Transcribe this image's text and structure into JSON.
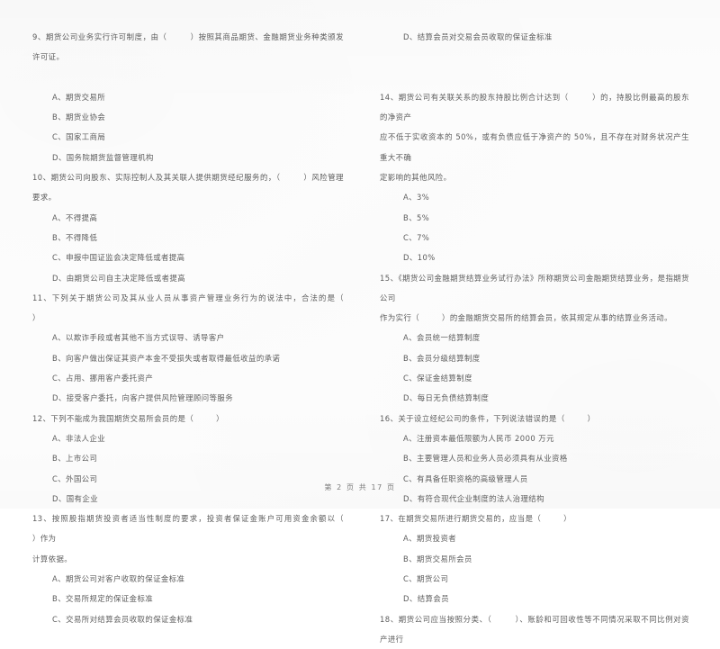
{
  "document": {
    "type": "exam-paper-scan",
    "language": "zh-CN",
    "footer": "第 2 页 共 17 页",
    "page_number": "2",
    "total_pages": "17"
  },
  "left_column": {
    "questions": [
      {
        "number": "9",
        "stem": "9、期货公司业务实行许可制度，由（        ）按照其商品期货、金融期货业务种类颁发许可证。",
        "blank_after_stem": true,
        "options": [
          "A、期货交易所",
          "B、期货业协会",
          "C、国家工商局",
          "D、国务院期货监督管理机构"
        ]
      },
      {
        "number": "10",
        "stem": "10、期货公司向股东、实际控制人及其关联人提供期货经纪服务的，（        ）风险管理要求。",
        "blank_after_stem": false,
        "options": [
          "A、不得提高",
          "B、不得降低",
          "C、申报中国证监会决定降低或者提高",
          "D、由期货公司自主决定降低或者提高"
        ]
      },
      {
        "number": "11",
        "stem": "11、下列关于期货公司及其从业人员从事资产管理业务行为的说法中，合法的是（        ）",
        "blank_after_stem": false,
        "options": [
          "A、以欺诈手段或者其他不当方式误导、诱导客户",
          "B、向客户做出保证其资产本金不受损失或者取得最低收益的承诺",
          "C、占用、挪用客户委托资产",
          "D、接受客户委托，向客户提供风险管理顾问等服务"
        ]
      },
      {
        "number": "12",
        "stem": "12、下列不能成为我国期货交易所会员的是（        ）",
        "blank_after_stem": false,
        "options": [
          "A、非法人企业",
          "B、上市公司",
          "C、外国公司",
          "D、国有企业"
        ]
      },
      {
        "number": "13",
        "stem": "13、按照股指期货投资者适当性制度的要求，投资者保证金账户可用资金余额以（        ）作为\n计算依据。",
        "blank_after_stem": false,
        "options": [
          "A、期货公司对客户收取的保证金标准",
          "B、交易所规定的保证金标准",
          "C、交易所对结算会员收取的保证金标准"
        ]
      }
    ]
  },
  "right_column": {
    "leading_option": "D、结算会员对交易会员收取的保证金标准",
    "questions": [
      {
        "number": "14",
        "stem": "14、期货公司有关联关系的股东持股比例合计达到（        ）的，持股比例最高的股东的净资产\n应不低于实收资本的 50%，或有负债应低于净资产的 50%，且不存在对财务状况产生重大不确\n定影响的其他风险。",
        "options": [
          "A、3%",
          "B、5%",
          "C、7%",
          "D、10%"
        ]
      },
      {
        "number": "15",
        "stem": "15、《期货公司金融期货结算业务试行办法》所称期货公司金融期货结算业务，是指期货公司\n作为实行（        ）的金融期货交易所的结算会员，依其规定从事的结算业务活动。",
        "options": [
          "A、会员统一结算制度",
          "B、会员分级结算制度",
          "C、保证金结算制度",
          "D、每日无负债结算制度"
        ]
      },
      {
        "number": "16",
        "stem": "16、关于设立经纪公司的条件，下列说法错误的是（        ）",
        "options": [
          "A、注册资本最低限额为人民币 2000 万元",
          "B、主要管理人员和业务人员必须具有从业资格",
          "C、有具备任职资格的高级管理人员",
          "D、有符合现代企业制度的法人治理结构"
        ]
      },
      {
        "number": "17",
        "stem": "17、在期货交易所进行期货交易的，应当是（        ）",
        "options": [
          "A、期货投资者",
          "B、期货交易所会员",
          "C、期货公司",
          "D、结算会员"
        ]
      },
      {
        "number": "18",
        "stem": "18、期货公司应当按照分类、（        ）、账龄和可回收性等不同情况采取不同比例对资产进行",
        "options": []
      }
    ]
  }
}
